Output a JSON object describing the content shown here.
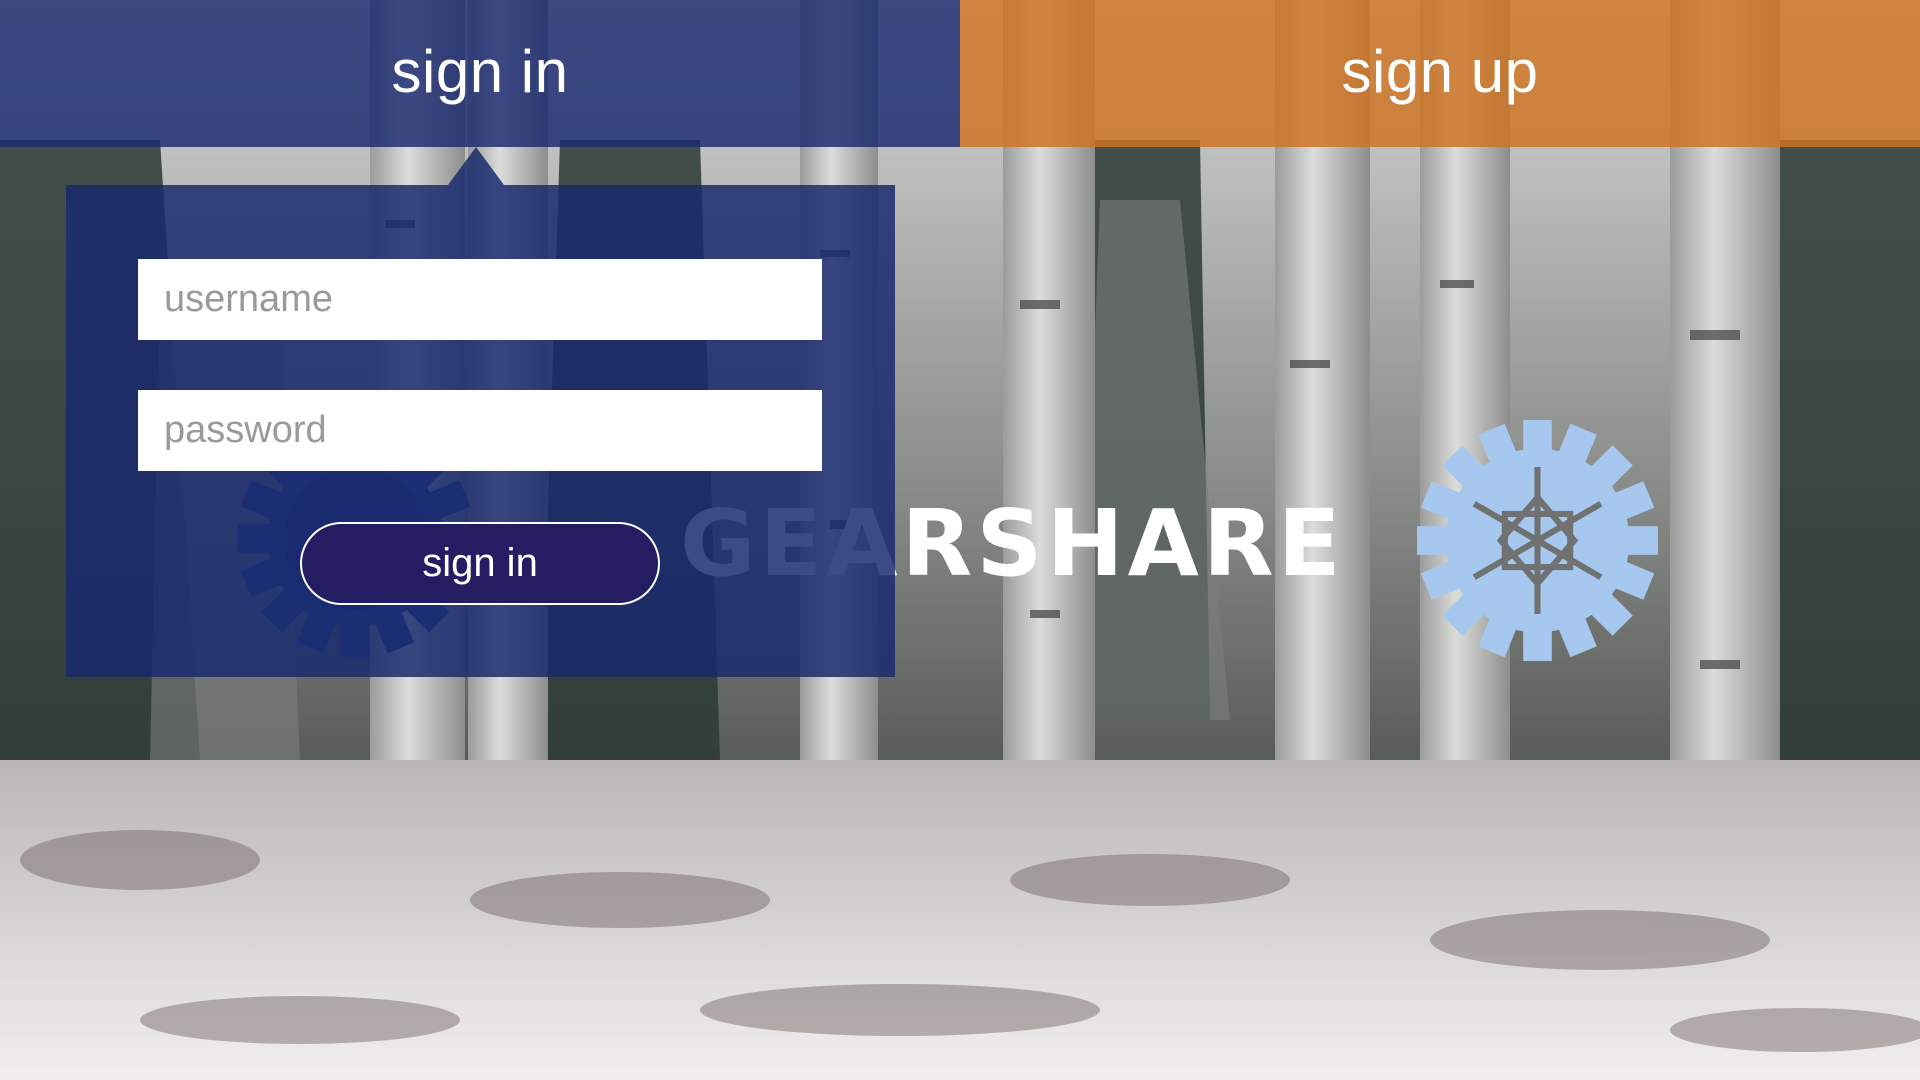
{
  "tabs": {
    "signin_label": "sign in",
    "signup_label": "sign up"
  },
  "signin_form": {
    "username_placeholder": "username",
    "password_placeholder": "password",
    "submit_label": "sign in"
  },
  "brand": {
    "wordmark": "GEARSHARE",
    "logo_icon": "gear-snowflake-icon"
  },
  "background": {
    "icon": "snowy-aspen-forest-photo"
  },
  "colors": {
    "signin_blue": "#18286e",
    "signup_orange": "#cd7323",
    "button_navy": "#241d62",
    "gear_light_blue": "#a6c8ee",
    "gear_dark_blue": "#2f4f95"
  }
}
